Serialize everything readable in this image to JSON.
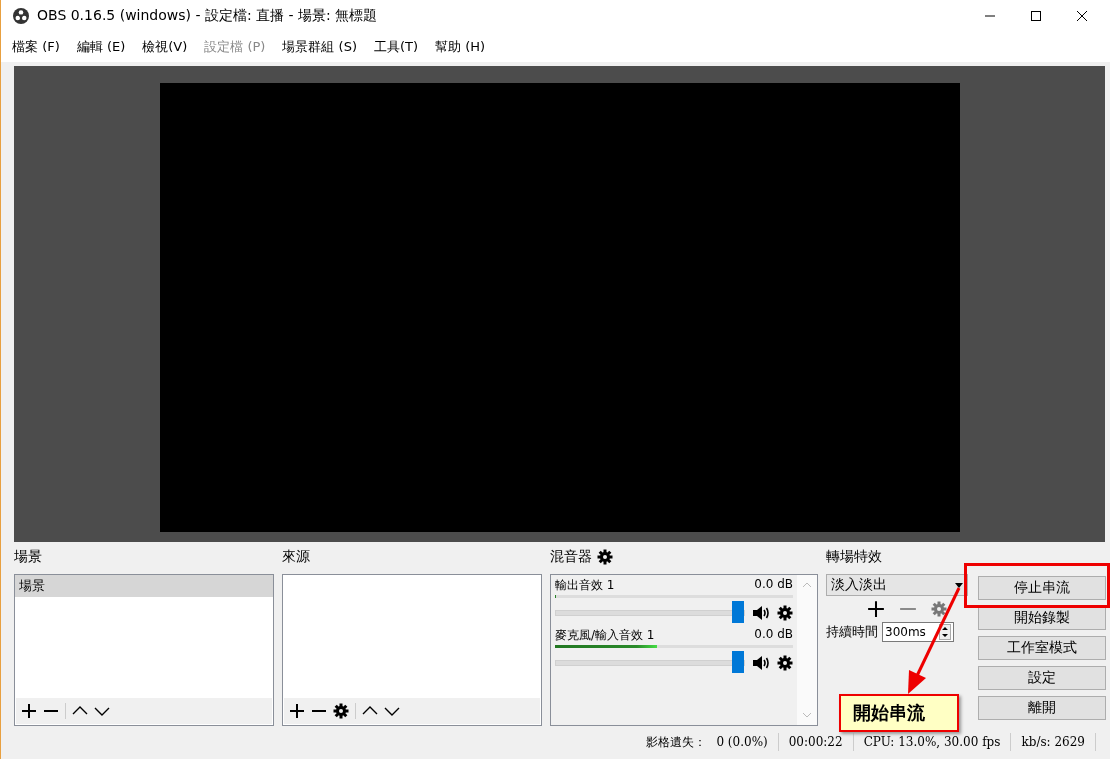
{
  "window": {
    "title": "OBS 0.16.5 (windows) - 設定檔: 直播 - 場景: 無標題"
  },
  "menu": [
    {
      "label": "檔案 (F)",
      "disabled": false
    },
    {
      "label": "編輯 (E)",
      "disabled": false
    },
    {
      "label": "檢視(V)",
      "disabled": false
    },
    {
      "label": "設定檔 (P)",
      "disabled": true
    },
    {
      "label": "場景群組 (S)",
      "disabled": false
    },
    {
      "label": "工具(T)",
      "disabled": false
    },
    {
      "label": "幫助 (H)",
      "disabled": false
    }
  ],
  "scenes": {
    "title": "場景",
    "items": [
      {
        "label": "場景",
        "selected": true
      }
    ]
  },
  "sources": {
    "title": "來源"
  },
  "mixer": {
    "title": "混音器",
    "channels": [
      {
        "name": "輸出音效 1",
        "reading": "0.0 dB",
        "meter": {
          "level": 0
        },
        "volume": {
          "level": 1
        }
      },
      {
        "name": "麥克風/輸入音效 1",
        "reading": "0.0 dB",
        "meter": {
          "level": 0.43
        },
        "volume": {
          "level": 1
        }
      }
    ]
  },
  "transitions": {
    "title": "轉場特效",
    "selected": "淡入淡出",
    "duration_label": "持續時間",
    "duration": "300ms"
  },
  "buttons": [
    "停止串流",
    "開始錄製",
    "工作室模式",
    "設定",
    "離開"
  ],
  "annotation": {
    "callout": "開始串流"
  },
  "status_bar": {
    "dropped_frames_label": "影格遺失：",
    "dropped_frames": "0 (0.0%)",
    "time": "00:00:22",
    "cpu": "CPU: 13.0%, 30.00 fps",
    "bitrate": "kb/s: 2629"
  }
}
